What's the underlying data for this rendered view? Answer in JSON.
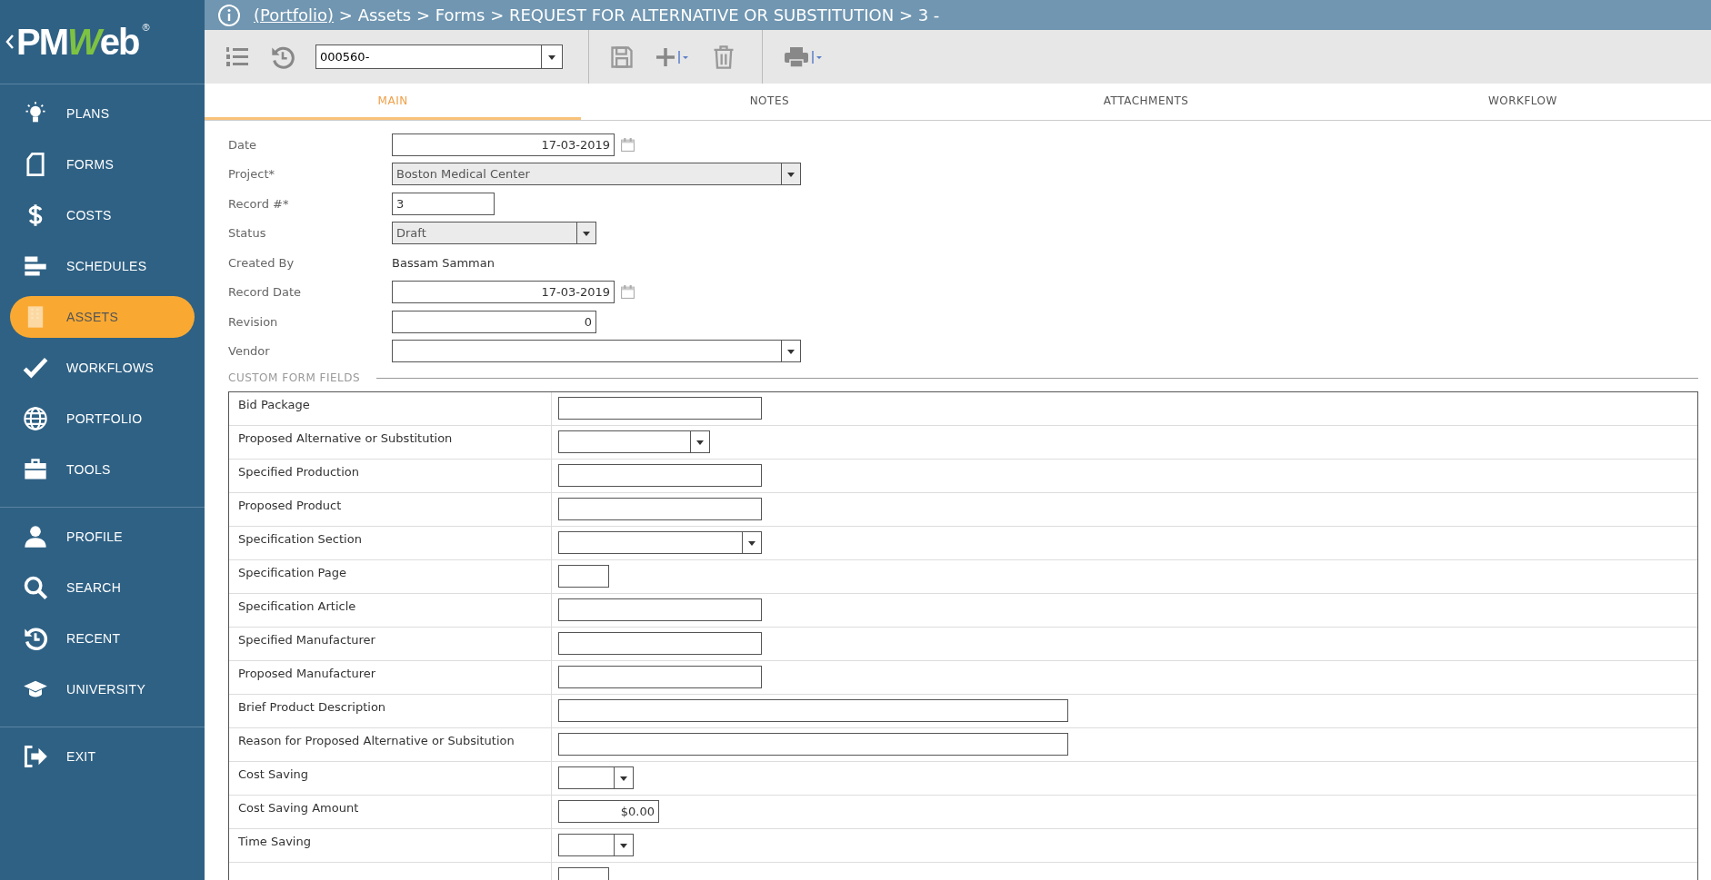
{
  "logo": {
    "lead": "PM",
    "accent": "W",
    "tail": "eb",
    "mark": "®"
  },
  "breadcrumb": {
    "link": "(Portfolio)",
    "rest": "> Assets > Forms > REQUEST FOR ALTERNATIVE OR SUBSTITUTION > 3 -"
  },
  "toolbar": {
    "record": "000560-"
  },
  "sidebar": {
    "groups": [
      [
        {
          "label": "PLANS",
          "kind": "bulb",
          "selected": false
        },
        {
          "label": "FORMS",
          "kind": "doc",
          "selected": false
        },
        {
          "label": "COSTS",
          "kind": "dollar",
          "selected": false
        },
        {
          "label": "SCHEDULES",
          "kind": "bars",
          "selected": false
        },
        {
          "label": "ASSETS",
          "kind": "building",
          "selected": true
        },
        {
          "label": "WORKFLOWS",
          "kind": "check",
          "selected": false
        },
        {
          "label": "PORTFOLIO",
          "kind": "globe",
          "selected": false
        },
        {
          "label": "TOOLS",
          "kind": "case",
          "selected": false
        }
      ],
      [
        {
          "label": "PROFILE",
          "kind": "person",
          "selected": false
        },
        {
          "label": "SEARCH",
          "kind": "search",
          "selected": false
        },
        {
          "label": "RECENT",
          "kind": "history",
          "selected": false
        },
        {
          "label": "UNIVERSITY",
          "kind": "cap",
          "selected": false
        }
      ],
      [
        {
          "label": "EXIT",
          "kind": "exit",
          "selected": false
        }
      ]
    ]
  },
  "tabs": [
    {
      "label": "MAIN",
      "selected": true
    },
    {
      "label": "NOTES",
      "selected": false
    },
    {
      "label": "ATTACHMENTS",
      "selected": false
    },
    {
      "label": "WORKFLOW",
      "selected": false
    }
  ],
  "fields": [
    {
      "label": "Date",
      "kind": "date",
      "value": "17-03-2019"
    },
    {
      "label": "Project*",
      "kind": "select-wide",
      "value": "Boston Medical Center",
      "disabled": true
    },
    {
      "label": "Record #*",
      "kind": "text-short",
      "value": "3"
    },
    {
      "label": "Status",
      "kind": "select",
      "value": "Draft",
      "disabled": true
    },
    {
      "label": "Created By",
      "kind": "static",
      "value": "Bassam Samman"
    },
    {
      "label": "Record Date",
      "kind": "date",
      "value": "17-03-2019"
    },
    {
      "label": "Revision",
      "kind": "number",
      "value": "0"
    },
    {
      "label": "Vendor",
      "kind": "select-wide",
      "disabled": false
    }
  ],
  "custom_section": {
    "title": "CUSTOM FORM FIELDS"
  },
  "custom_fields": [
    {
      "label": "Bid Package",
      "kind": "text"
    },
    {
      "label": "Proposed Alternative or Substitution",
      "kind": "select-mid"
    },
    {
      "label": "Specified Production",
      "kind": "text"
    },
    {
      "label": "Proposed Product",
      "kind": "text"
    },
    {
      "label": "Specification Section",
      "kind": "select-long"
    },
    {
      "label": "Specification Page",
      "kind": "tiny"
    },
    {
      "label": "Specification Article",
      "kind": "text"
    },
    {
      "label": "Specified Manufacturer",
      "kind": "text"
    },
    {
      "label": "Proposed Manufacturer",
      "kind": "text"
    },
    {
      "label": "Brief Product Description",
      "kind": "long"
    },
    {
      "label": "Reason for Proposed Alternative or Subsitution",
      "kind": "long"
    },
    {
      "label": "Cost Saving",
      "kind": "select-small"
    },
    {
      "label": "Cost Saving Amount",
      "kind": "currency",
      "value": "$0.00"
    },
    {
      "label": "Time Saving",
      "kind": "select-small"
    },
    {
      "kind": "tiny"
    }
  ]
}
